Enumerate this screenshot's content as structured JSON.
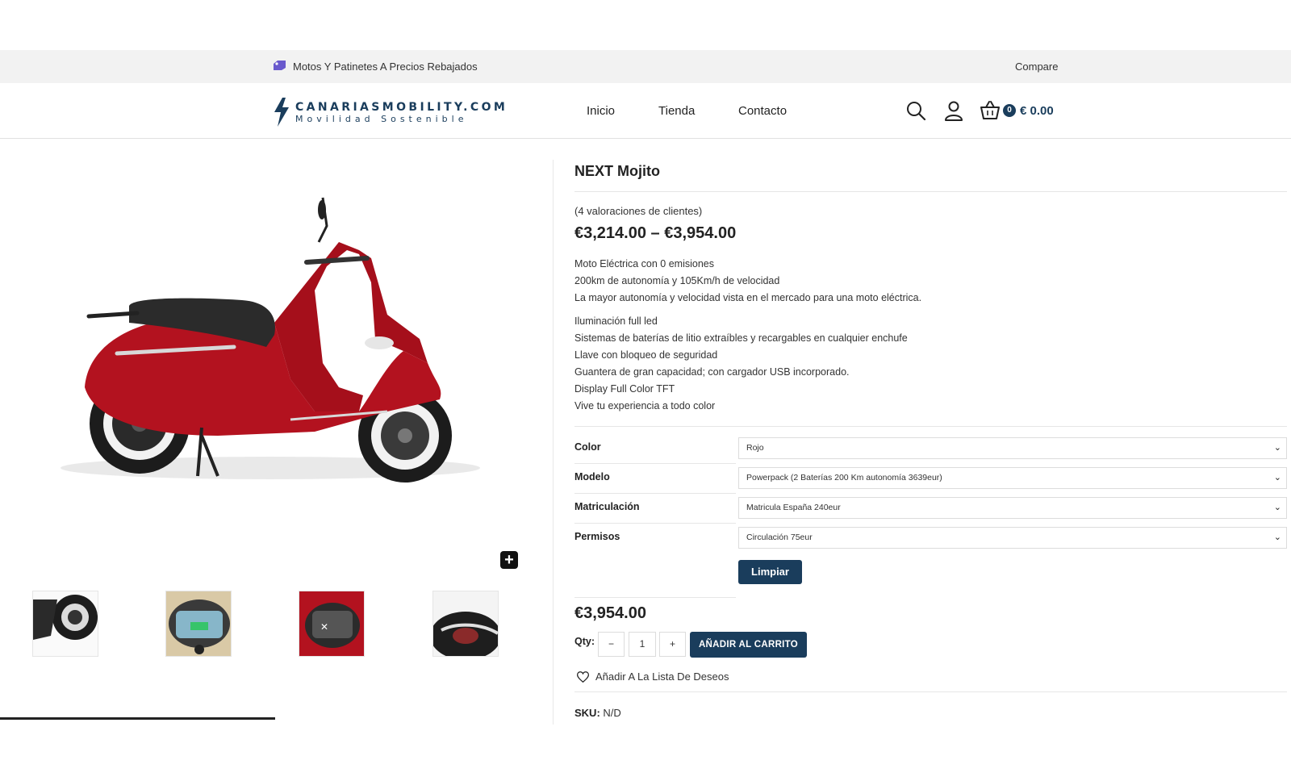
{
  "topbar": {
    "promo_icon": "tag-icon",
    "promo_text": "Motos Y Patinetes A Precios Rebajados",
    "compare": "Compare"
  },
  "header": {
    "logo_brand": "CANARIASMOBILITY.COM",
    "logo_tagline": "Movilidad Sostenible",
    "nav": [
      "Inicio",
      "Tienda",
      "Contacto"
    ],
    "icons": [
      "search-icon",
      "user-icon",
      "cart-icon"
    ],
    "cart_count": "0",
    "cart_total": "€ 0.00"
  },
  "gallery": {
    "zoom_icon": "plus-icon",
    "thumbnails": [
      "rear-wheel",
      "dashboard-display",
      "front-display",
      "headlight-detail"
    ]
  },
  "product": {
    "title": "NEXT Mojito",
    "reviews": "(4 valoraciones de clientes)",
    "price_range": "€3,214.00 – €3,954.00",
    "description_a": [
      "Moto Eléctrica con 0 emisiones",
      "200km de autonomía y 105Km/h de velocidad",
      "La mayor autonomía y velocidad vista en el mercado para una moto eléctrica."
    ],
    "description_b": [
      "Iluminación full led",
      "Sistemas de baterías de litio extraíbles y recargables en cualquier enchufe",
      "Llave con bloqueo de seguridad",
      "Guantera de gran capacidad; con cargador USB incorporado.",
      "Display Full Color TFT",
      "Vive tu experiencia a todo color"
    ],
    "attributes": [
      {
        "label": "Color",
        "value": "Rojo"
      },
      {
        "label": "Modelo",
        "value": "Powerpack (2 Baterías 200 Km autonomía 3639eur)"
      },
      {
        "label": "Matriculación",
        "value": "Matricula España 240eur"
      },
      {
        "label": "Permisos",
        "value": "Circulación 75eur"
      }
    ],
    "clear_button": "Limpiar",
    "final_price": "€3,954.00",
    "qty_label": "Qty:",
    "qty_minus": "−",
    "qty_value": "1",
    "qty_plus": "+",
    "add_to_cart": "AÑADIR AL CARRITO",
    "wishlist": "Añadir A La Lista De Deseos",
    "sku_label": "SKU:",
    "sku_value": "N/D"
  },
  "colors": {
    "brand": "#1a3d5c",
    "scooter_red": "#b3121f",
    "topbar_bg": "#f2f2f2"
  }
}
